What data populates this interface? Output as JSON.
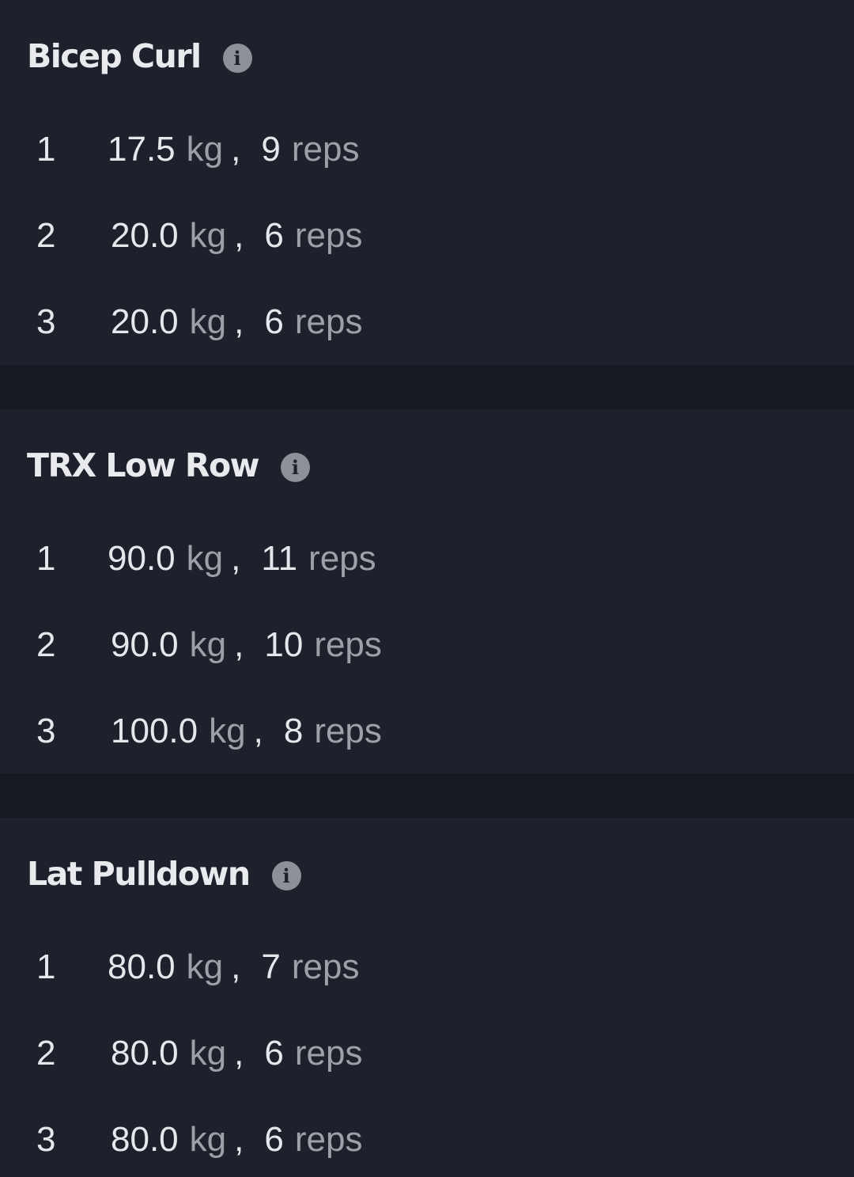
{
  "exercises": [
    {
      "name": "Bicep Curl",
      "info_icon": "info-icon",
      "sets": [
        {
          "num": "1",
          "weight": "17.5",
          "weight_unit": "kg",
          "sep": ",",
          "reps": "9",
          "reps_unit": "reps"
        },
        {
          "num": "2",
          "weight": "20.0",
          "weight_unit": "kg",
          "sep": ",",
          "reps": "6",
          "reps_unit": "reps"
        },
        {
          "num": "3",
          "weight": "20.0",
          "weight_unit": "kg",
          "sep": ",",
          "reps": "6",
          "reps_unit": "reps"
        }
      ]
    },
    {
      "name": "TRX Low Row",
      "info_icon": "info-icon",
      "sets": [
        {
          "num": "1",
          "weight": "90.0",
          "weight_unit": "kg",
          "sep": ",",
          "reps": "11",
          "reps_unit": "reps"
        },
        {
          "num": "2",
          "weight": "90.0",
          "weight_unit": "kg",
          "sep": ",",
          "reps": "10",
          "reps_unit": "reps"
        },
        {
          "num": "3",
          "weight": "100.0",
          "weight_unit": "kg",
          "sep": ",",
          "reps": "8",
          "reps_unit": "reps"
        }
      ]
    },
    {
      "name": "Lat Pulldown",
      "info_icon": "info-icon",
      "sets": [
        {
          "num": "1",
          "weight": "80.0",
          "weight_unit": "kg",
          "sep": ",",
          "reps": "7",
          "reps_unit": "reps"
        },
        {
          "num": "2",
          "weight": "80.0",
          "weight_unit": "kg",
          "sep": ",",
          "reps": "6",
          "reps_unit": "reps"
        },
        {
          "num": "3",
          "weight": "80.0",
          "weight_unit": "kg",
          "sep": ",",
          "reps": "6",
          "reps_unit": "reps"
        }
      ]
    }
  ],
  "icon_glyph": "i",
  "colors": {
    "background": "#181a23",
    "card": "#1e202c",
    "text_primary": "#e6e7eb",
    "text_muted": "#9ea0a8",
    "icon": "#8e9097"
  }
}
